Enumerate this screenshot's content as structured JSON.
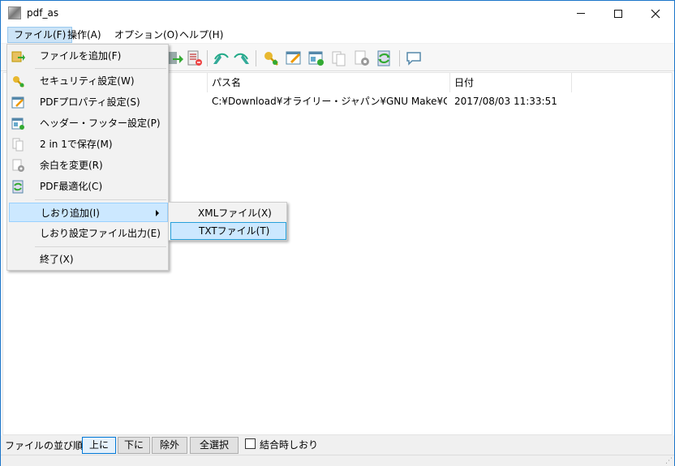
{
  "window": {
    "title": "pdf_as"
  },
  "menubar": [
    {
      "label": "ファイル(F)"
    },
    {
      "label": "操作(A)"
    },
    {
      "label": "オプション(O)"
    },
    {
      "label": "ヘルプ(H)"
    }
  ],
  "file_menu": {
    "items": [
      {
        "label": "ファイルを追加(F)",
        "icon": "add-file-icon"
      },
      {
        "label": "セキュリティ設定(W)",
        "icon": "key-icon"
      },
      {
        "label": "PDFプロパティ設定(S)",
        "icon": "properties-icon"
      },
      {
        "label": "ヘッダー・フッター設定(P)",
        "icon": "header-footer-icon"
      },
      {
        "label": "2 in 1で保存(M)",
        "icon": "two-in-one-icon"
      },
      {
        "label": "余白を変更(R)",
        "icon": "margin-gear-icon"
      },
      {
        "label": "PDF最適化(C)",
        "icon": "optimize-icon"
      },
      {
        "label": "しおり追加(I)"
      },
      {
        "label": "しおり設定ファイル出力(E)"
      },
      {
        "label": "終了(X)"
      }
    ]
  },
  "bookmark_submenu": {
    "items": [
      {
        "label": "XMLファイル(X)"
      },
      {
        "label": "TXTファイル(T)"
      }
    ]
  },
  "list": {
    "columns": [
      "パス名",
      "日付"
    ],
    "rows": [
      {
        "path": "C:¥Download¥オライリー・ジャパン¥GNU Make¥GNU Ma...",
        "date": "2017/08/03 11:33:51"
      }
    ]
  },
  "bottom": {
    "sort_label": "ファイルの並び順:",
    "up": "上に",
    "down": "下に",
    "remove": "除外",
    "select_all": "全選択",
    "bookmark_on_merge": "結合時しおり"
  },
  "colors": {
    "accent": "#0078d7",
    "menu_highlight": "#cce8ff"
  }
}
